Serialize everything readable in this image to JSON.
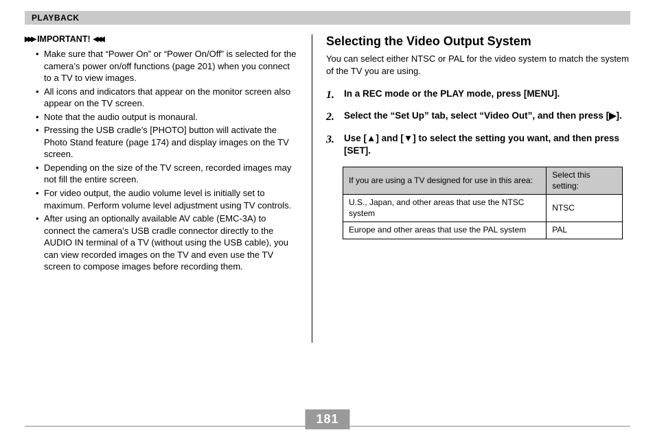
{
  "header": {
    "section": "PLAYBACK"
  },
  "left": {
    "important_label": "IMPORTANT!",
    "bullets": [
      "Make sure that “Power On” or “Power On/Off” is selected for the camera’s power on/off functions (page 201) when you connect to a TV to view images.",
      "All icons and indicators that appear on the monitor screen also appear on the TV screen.",
      "Note that the audio output is monaural.",
      "Pressing the USB cradle’s [PHOTO] button will activate the Photo Stand feature (page 174) and display images on the TV screen.",
      "Depending on the size of the TV screen, recorded images may not fill the entire screen.",
      "For video output, the audio volume level is initially set to maximum. Perform volume level adjustment using TV controls.",
      "After using an optionally available AV cable (EMC-3A) to connect the camera’s USB cradle connector directly to the AUDIO IN terminal of a TV (without using the USB cable), you can view recorded images on the TV and even use the TV screen to compose images before recording them."
    ]
  },
  "right": {
    "title": "Selecting the Video Output System",
    "intro": "You can select either NTSC or PAL for the video system to match the system of the TV you are using.",
    "steps": [
      "In a REC mode or the PLAY mode, press [MENU].",
      "Select the “Set Up” tab, select “Video Out”, and then press [▶].",
      "Use [▲] and [▼] to select the setting you want, and then press [SET]."
    ],
    "table": {
      "head": [
        "If you are using a TV designed for use in this area:",
        "Select this setting:"
      ],
      "rows": [
        [
          "U.S., Japan, and other areas that use the NTSC system",
          "NTSC"
        ],
        [
          "Europe and other areas that use the PAL system",
          "PAL"
        ]
      ]
    }
  },
  "page_number": "181"
}
